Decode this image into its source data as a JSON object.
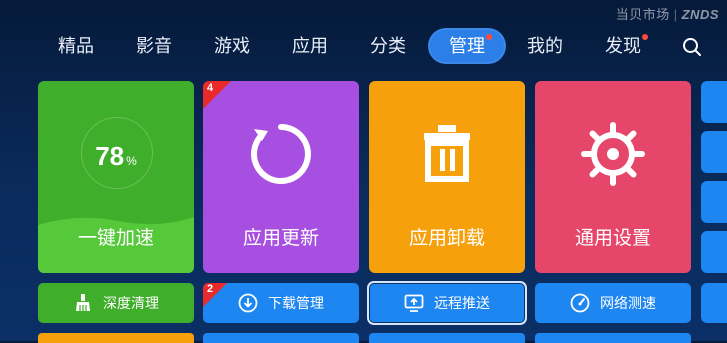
{
  "watermark": {
    "text": "当贝市场",
    "brand": "ZNDS"
  },
  "nav": {
    "items": [
      {
        "label": "精品"
      },
      {
        "label": "影音"
      },
      {
        "label": "游戏"
      },
      {
        "label": "应用"
      },
      {
        "label": "分类"
      },
      {
        "label": "管理",
        "active": true,
        "dot": true
      },
      {
        "label": "我的"
      },
      {
        "label": "发现",
        "dot": true
      }
    ],
    "search_icon": "search-icon"
  },
  "tiles": {
    "speed": {
      "label": "一键加速",
      "percent": "78",
      "unit": "%"
    },
    "update": {
      "label": "应用更新",
      "badge": "4",
      "icon": "refresh-icon"
    },
    "uninstall": {
      "label": "应用卸载",
      "icon": "trash-icon"
    },
    "settings": {
      "label": "通用设置",
      "icon": "gear-icon"
    }
  },
  "buttons": {
    "clean": {
      "label": "深度清理",
      "icon": "broom-icon"
    },
    "download": {
      "label": "下载管理",
      "badge": "2",
      "icon": "download-icon"
    },
    "remote": {
      "label": "远程推送",
      "icon": "screen-push-icon"
    },
    "network": {
      "label": "网络测速",
      "icon": "speedometer-icon"
    }
  },
  "colors": {
    "background": "#0a2b5c",
    "green": "#3fae2a",
    "purple": "#a74fe0",
    "orange": "#f6a10c",
    "pink": "#e6466a",
    "blue": "#1d86f0",
    "nav_active": "#2b7fe6",
    "badge_red": "#e82a2a"
  }
}
